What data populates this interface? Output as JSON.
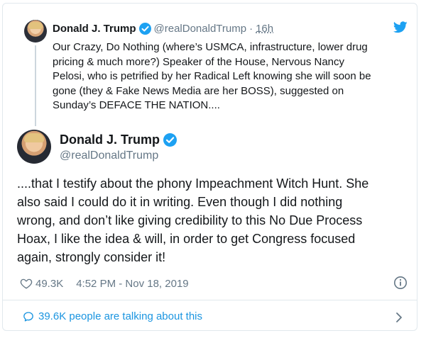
{
  "parent_tweet": {
    "name": "Donald J. Trump",
    "handle": "@realDonaldTrump",
    "separator": "·",
    "time": "16h",
    "text": "Our Crazy, Do Nothing (where’s USMCA, infrastructure, lower drug\npricing & much more?) Speaker of the House, Nervous Nancy\nPelosi, who is petrified by her Radical Left knowing she will soon be\ngone (they & Fake News Media are her BOSS), suggested on\nSunday’s DEFACE THE NATION...."
  },
  "main_tweet": {
    "name": "Donald J. Trump",
    "handle": "@realDonaldTrump",
    "text": "....that I testify about the phony Impeachment Witch Hunt. She\nalso said I could do it in writing. Even though I did nothing\nwrong, and don’t like giving credibility to this No Due Process\nHoax, I like the idea & will, in order to get Congress focused\nagain, strongly consider it!",
    "likes": "49.3K",
    "timestamp": "4:52 PM - Nov 18, 2019"
  },
  "footer": {
    "talking_label": "39.6K people are talking about this"
  },
  "icons": {
    "verified": "verified-badge-icon",
    "bird": "twitter-bird-icon",
    "heart": "heart-icon",
    "info": "info-icon",
    "comment": "comment-bubble-icon",
    "chevron": "chevron-right-icon"
  },
  "colors": {
    "accent": "#1da1f2",
    "link": "#1b95e0",
    "muted": "#657786",
    "text": "#14171a",
    "border": "#e1e8ed"
  }
}
